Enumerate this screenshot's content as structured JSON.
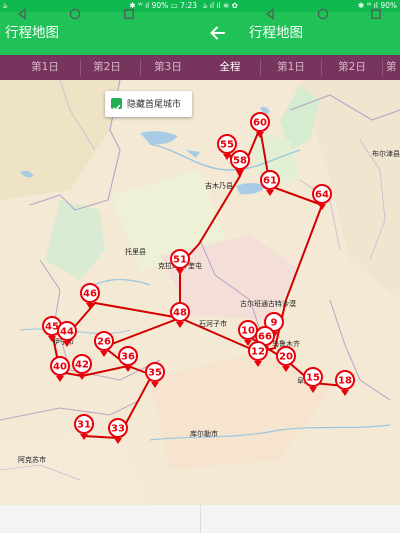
{
  "left_status": {
    "time_left": "ঌ",
    "right": "✱ ᵂ ıl 90% ▭ 7:23"
  },
  "right_status": {
    "time_left": "ঌ ıl ıl ≋ ✿",
    "right": "✱ ᵂ ıl 90%"
  },
  "left_appbar": {
    "title": "行程地图"
  },
  "right_appbar": {
    "title": "行程地图"
  },
  "left_tabs": [
    "第1日",
    "第2日",
    "第3日"
  ],
  "right_tabs": [
    "全程",
    "第1日",
    "第2日",
    "第"
  ],
  "hide_option": {
    "label": "隐藏首尾城市",
    "checked": true
  },
  "map_labels": [
    "吉木乃县",
    "托里县",
    "克拉玛依",
    "伊宁市",
    "石河子市",
    "古尔班通古特沙漠",
    "阜康市",
    "库尔勒市",
    "阿克苏市",
    "布尔津县",
    "奎屯",
    "乌鲁木齐"
  ],
  "route_markers": [
    "60",
    "55",
    "58",
    "61",
    "64",
    "51",
    "46",
    "48",
    "45",
    "44",
    "26",
    "10",
    "9",
    "66",
    "40",
    "42",
    "36",
    "12",
    "20",
    "15",
    "18",
    "35",
    "31",
    "33"
  ],
  "colors": {
    "statusbar": "#10b94f",
    "appbar": "#20c157",
    "tabbar": "#77355d",
    "route": "#d40000",
    "marker": "#e8000a"
  }
}
